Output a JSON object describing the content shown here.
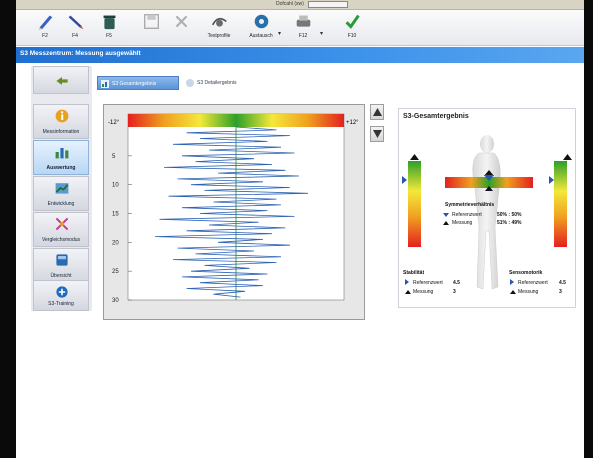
{
  "top_strip": {
    "label": "Dofcahl (sw)"
  },
  "toolbar": {
    "buttons": [
      {
        "name": "f2-button",
        "label": "F2",
        "icon": "pencil-icon"
      },
      {
        "name": "f4-button",
        "label": "F4",
        "icon": "pen-icon"
      },
      {
        "name": "f5-button",
        "label": "F5",
        "icon": "trash-icon"
      },
      {
        "name": "save-button",
        "label": "",
        "icon": "floppy-icon"
      },
      {
        "name": "cancel-button",
        "label": "",
        "icon": "x-icon"
      },
      {
        "name": "testprofile-button",
        "label": "Testprofile",
        "icon": "profile-icon"
      },
      {
        "name": "austausch-button",
        "label": "Austausch",
        "icon": "exchange-icon"
      },
      {
        "name": "f12-button",
        "label": "F12",
        "icon": "printer-icon"
      },
      {
        "name": "f10-button",
        "label": "F10",
        "icon": "check-icon"
      }
    ]
  },
  "titlebar": {
    "text": "S3 Messzentrum: Messung ausgewählt"
  },
  "sidebar": {
    "items": [
      {
        "label": "",
        "icon": "arrow-icon"
      },
      {
        "label": "Messinformation",
        "icon": "info-icon"
      },
      {
        "label": "Auswertung",
        "icon": "chart-icon"
      },
      {
        "label": "Entwicklung",
        "icon": "trend-icon"
      },
      {
        "label": "Vergleichsmodus",
        "icon": "compare-icon"
      },
      {
        "label": "Übersicht",
        "icon": "overview-icon"
      },
      {
        "label": "S3-Training",
        "icon": "training-icon"
      }
    ],
    "active_index": 2
  },
  "tabs": [
    {
      "label": "S3 Gesamtergebnis",
      "active": true
    },
    {
      "label": "S3 Detailergebnis",
      "active": false
    }
  ],
  "chart_data": {
    "type": "line",
    "x_range_labels": [
      "-12°",
      "+12°"
    ],
    "ylim": [
      0,
      30
    ],
    "y_ticks": [
      5,
      10,
      15,
      20,
      25,
      30
    ],
    "xlim": [
      -12,
      12
    ],
    "gradient": [
      "#e32020",
      "#f0a020",
      "#f4e83a",
      "#2ca028",
      "#f4e83a",
      "#f0a020",
      "#e32020"
    ],
    "series": [
      {
        "color": "#2c62b4",
        "points": [
          [
            0.0,
            0
          ],
          [
            4.5,
            0.5
          ],
          [
            -5.5,
            1.0
          ],
          [
            6.0,
            1.5
          ],
          [
            -4.0,
            2.0
          ],
          [
            3.5,
            2.5
          ],
          [
            -7.0,
            3.0
          ],
          [
            5.0,
            3.5
          ],
          [
            -3.0,
            4.0
          ],
          [
            6.5,
            4.5
          ],
          [
            -6.0,
            5.0
          ],
          [
            2.0,
            5.5
          ],
          [
            -4.5,
            6.0
          ],
          [
            4.0,
            6.5
          ],
          [
            -8.0,
            7.0
          ],
          [
            5.5,
            7.5
          ],
          [
            -2.0,
            8.0
          ],
          [
            7.0,
            8.5
          ],
          [
            -6.5,
            9.0
          ],
          [
            3.0,
            9.5
          ],
          [
            -5.0,
            10.0
          ],
          [
            6.0,
            10.5
          ],
          [
            -3.5,
            11.0
          ],
          [
            8.0,
            11.5
          ],
          [
            -7.5,
            12.0
          ],
          [
            4.5,
            12.5
          ],
          [
            -2.5,
            13.0
          ],
          [
            5.0,
            13.5
          ],
          [
            -6.0,
            14.0
          ],
          [
            3.5,
            14.5
          ],
          [
            -4.0,
            15.0
          ],
          [
            6.5,
            15.5
          ],
          [
            -8.5,
            16.0
          ],
          [
            2.5,
            16.5
          ],
          [
            -3.0,
            17.0
          ],
          [
            5.5,
            17.5
          ],
          [
            -5.5,
            18.0
          ],
          [
            4.0,
            18.5
          ],
          [
            -9.0,
            19.0
          ],
          [
            3.0,
            19.5
          ],
          [
            -2.0,
            20.0
          ],
          [
            6.0,
            20.5
          ],
          [
            -6.5,
            21.0
          ],
          [
            2.0,
            21.5
          ],
          [
            -4.5,
            22.0
          ],
          [
            5.0,
            22.5
          ],
          [
            -7.0,
            23.0
          ],
          [
            4.5,
            23.5
          ],
          [
            -3.5,
            24.0
          ],
          [
            1.5,
            24.5
          ],
          [
            -5.0,
            25.0
          ],
          [
            3.5,
            25.5
          ],
          [
            -6.0,
            26.0
          ],
          [
            2.5,
            26.5
          ],
          [
            -4.0,
            27.0
          ],
          [
            3.0,
            27.5
          ],
          [
            -5.5,
            28.0
          ],
          [
            1.0,
            28.5
          ],
          [
            -2.5,
            29.0
          ],
          [
            0.5,
            29.5
          ]
        ]
      }
    ]
  },
  "result_panel": {
    "title": "S3-Gesamtergebnis",
    "symmetry": {
      "heading": "Symmetrieverhältnis",
      "ref_label": "Referenzwert",
      "ref_value": "50% : 50%",
      "meas_label": "Messung",
      "meas_value": "51% : 49%"
    },
    "stability": {
      "heading": "Stabilität",
      "ref_label": "Referenzwert",
      "ref_value": "4.5",
      "meas_label": "Messung",
      "meas_value": "3"
    },
    "sensomotorik": {
      "heading": "Sensomotorik",
      "ref_label": "Referenzwert",
      "ref_value": "4.5",
      "meas_label": "Messung",
      "meas_value": "3"
    },
    "colors": {
      "ref_marker": "#2456b6",
      "meas_marker": "#111111"
    }
  }
}
